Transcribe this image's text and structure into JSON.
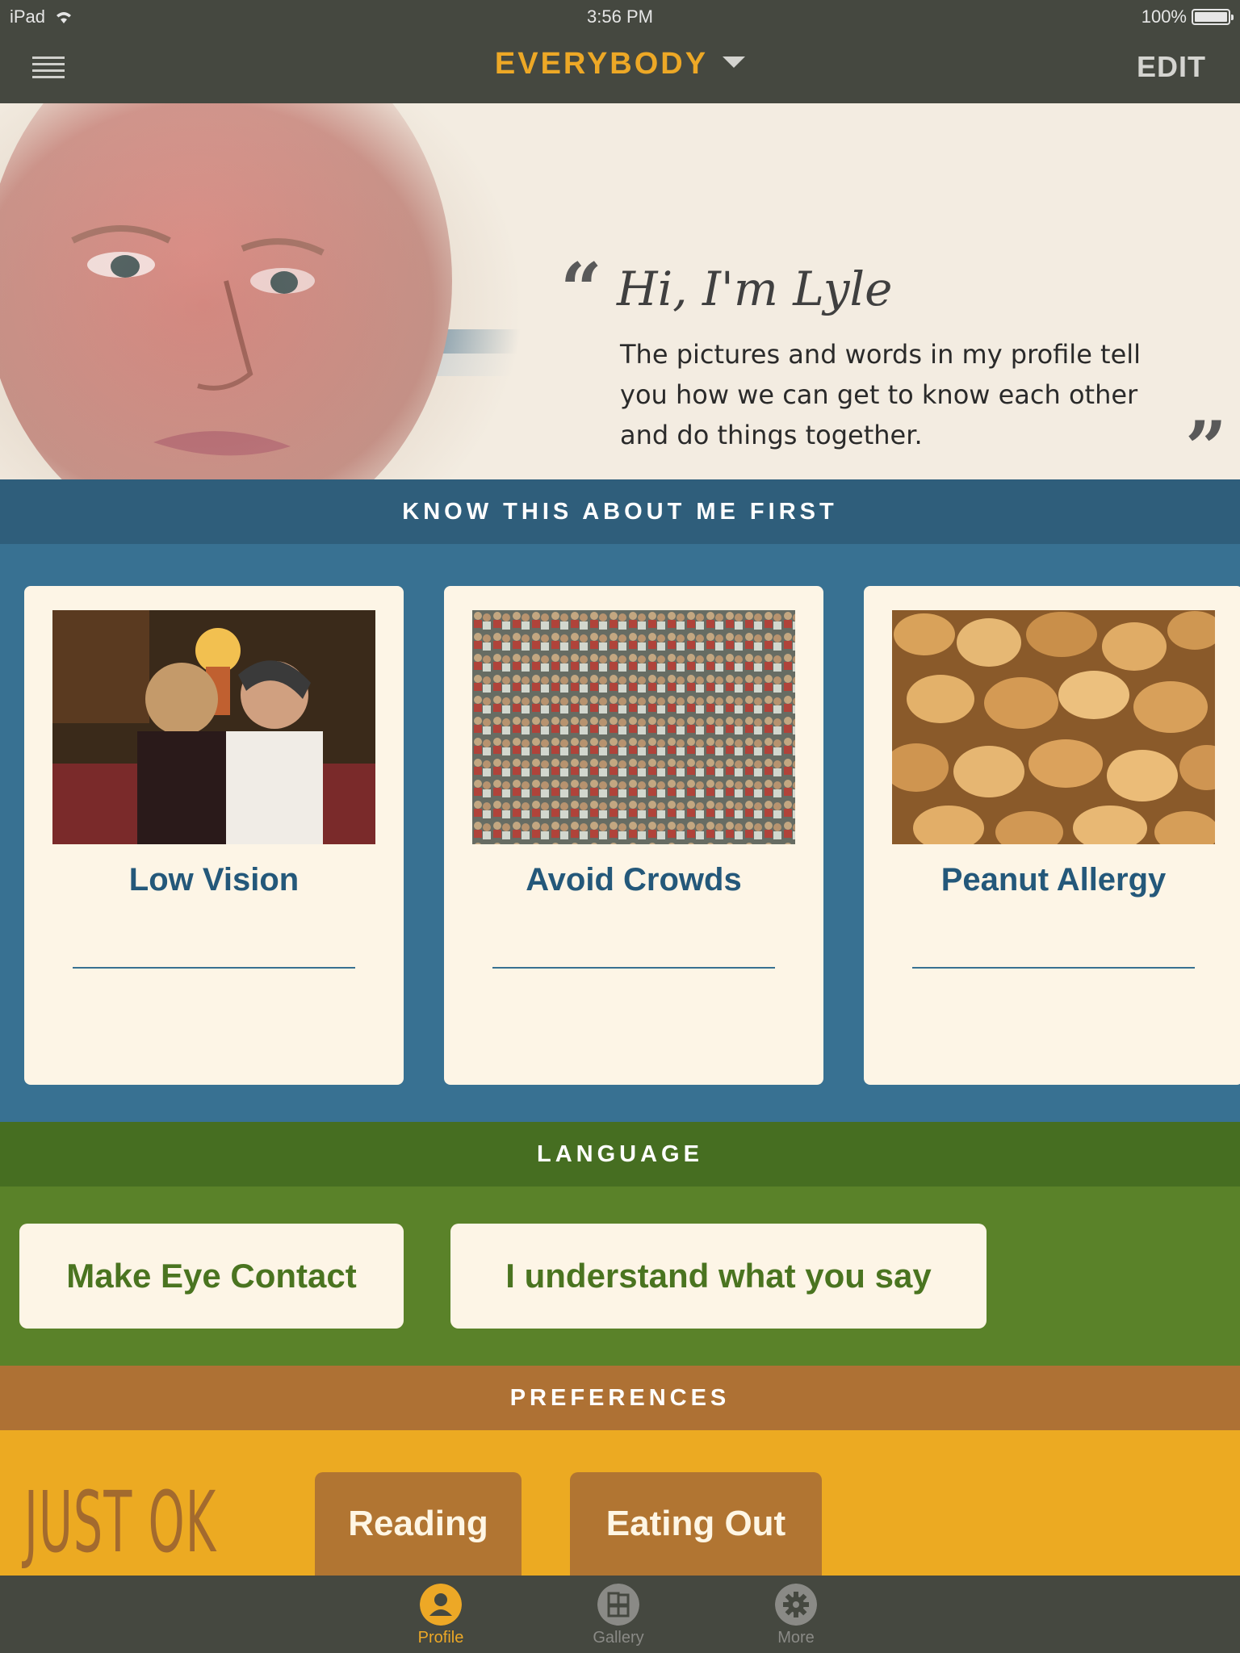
{
  "status_bar": {
    "device": "iPad",
    "time": "3:56 PM",
    "battery": "100%"
  },
  "nav": {
    "title": "EVERYBODY",
    "edit_label": "EDIT"
  },
  "profile": {
    "greeting": "Hi, I'm Lyle",
    "intro": "The pictures and words in my profile tell you how we can get to know each other and do things together.",
    "quote_open": "“",
    "quote_close": "”"
  },
  "know_first": {
    "heading": "KNOW THIS ABOUT ME FIRST",
    "cards": [
      {
        "title": "Low Vision"
      },
      {
        "title": "Avoid Crowds"
      },
      {
        "title": "Peanut Allergy"
      }
    ]
  },
  "language": {
    "heading": "LANGUAGE",
    "items": [
      {
        "label": "Make Eye Contact"
      },
      {
        "label": "I understand what you say"
      }
    ]
  },
  "preferences": {
    "heading": "PREFERENCES",
    "level": "JUST OK",
    "items": [
      {
        "label": "Reading"
      },
      {
        "label": "Eating Out"
      }
    ]
  },
  "tabs": [
    {
      "label": "Profile",
      "icon": "person-icon",
      "active": true
    },
    {
      "label": "Gallery",
      "icon": "gallery-icon",
      "active": false
    },
    {
      "label": "More",
      "icon": "gear-icon",
      "active": false
    }
  ],
  "colors": {
    "accent": "#eda826",
    "topbar": "#454840",
    "know_blue": "#387192",
    "language_green": "#5a8229",
    "preferences_orange": "#ecaa22",
    "preferences_brown": "#b17532"
  }
}
